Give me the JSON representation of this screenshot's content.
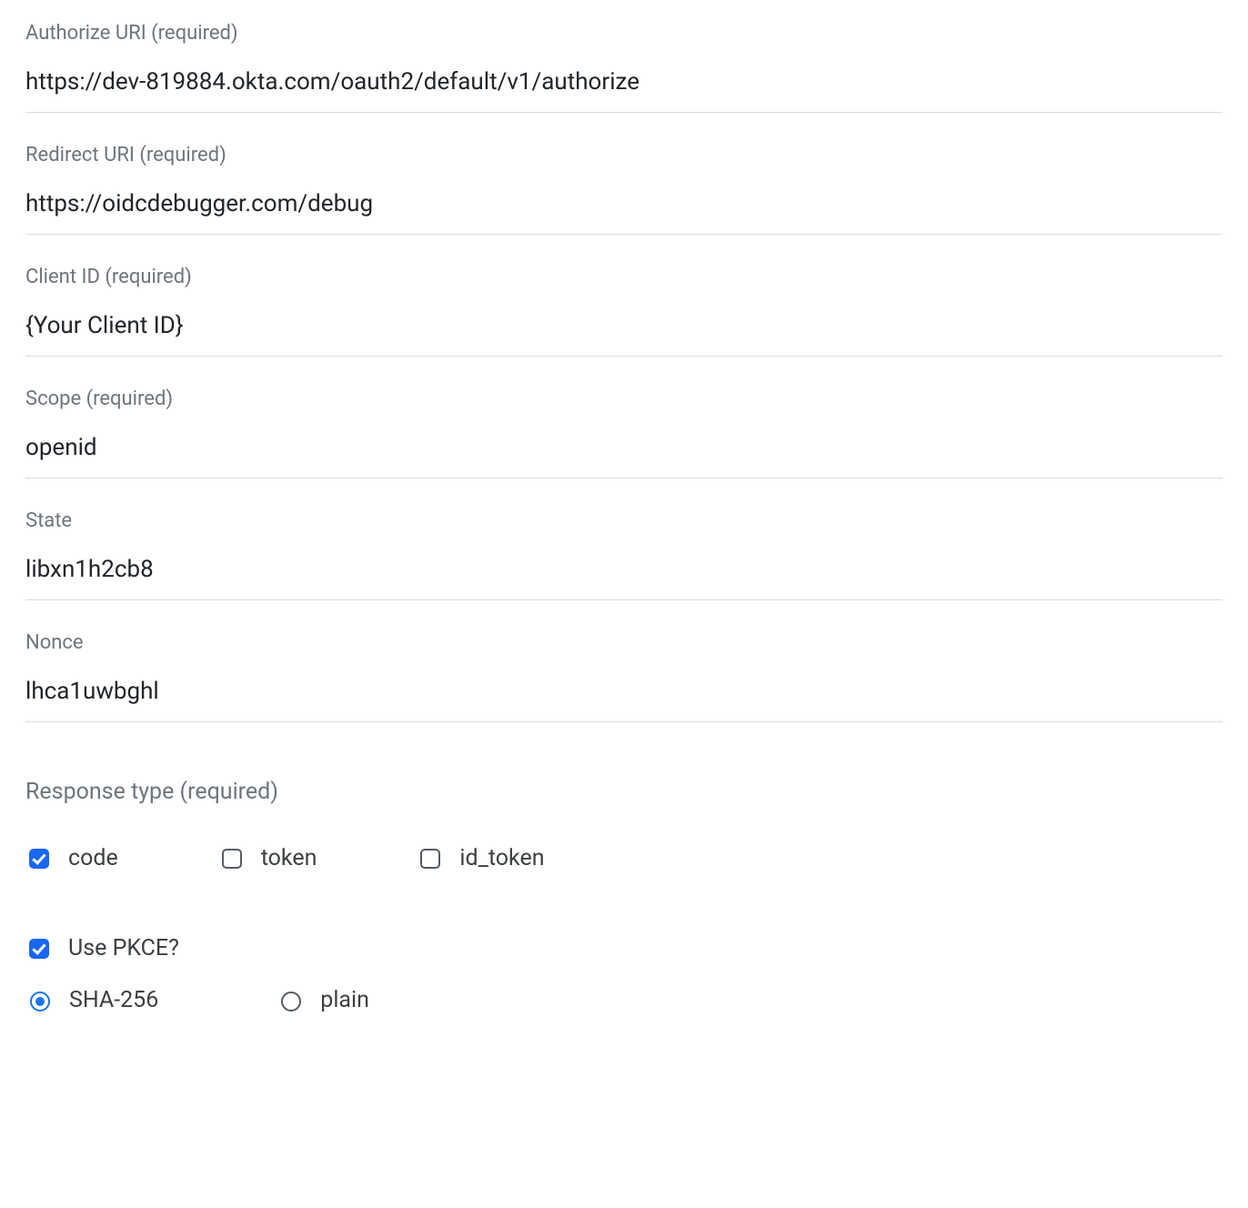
{
  "fields": {
    "authorize_uri": {
      "label": "Authorize URI (required)",
      "value": "https://dev-819884.okta.com/oauth2/default/v1/authorize"
    },
    "redirect_uri": {
      "label": "Redirect URI (required)",
      "value": "https://oidcdebugger.com/debug"
    },
    "client_id": {
      "label": "Client ID (required)",
      "value": "{Your Client ID}"
    },
    "scope": {
      "label": "Scope (required)",
      "value": "openid"
    },
    "state": {
      "label": "State",
      "value": "libxn1h2cb8"
    },
    "nonce": {
      "label": "Nonce",
      "value": "lhca1uwbghl"
    }
  },
  "response_type": {
    "title": "Response type (required)",
    "options": {
      "code": {
        "label": "code",
        "checked": true
      },
      "token": {
        "label": "token",
        "checked": false
      },
      "id_token": {
        "label": "id_token",
        "checked": false
      }
    }
  },
  "pkce": {
    "use_label": "Use PKCE?",
    "use_checked": true,
    "method": {
      "sha256": {
        "label": "SHA-256",
        "selected": true
      },
      "plain": {
        "label": "plain",
        "selected": false
      }
    }
  }
}
